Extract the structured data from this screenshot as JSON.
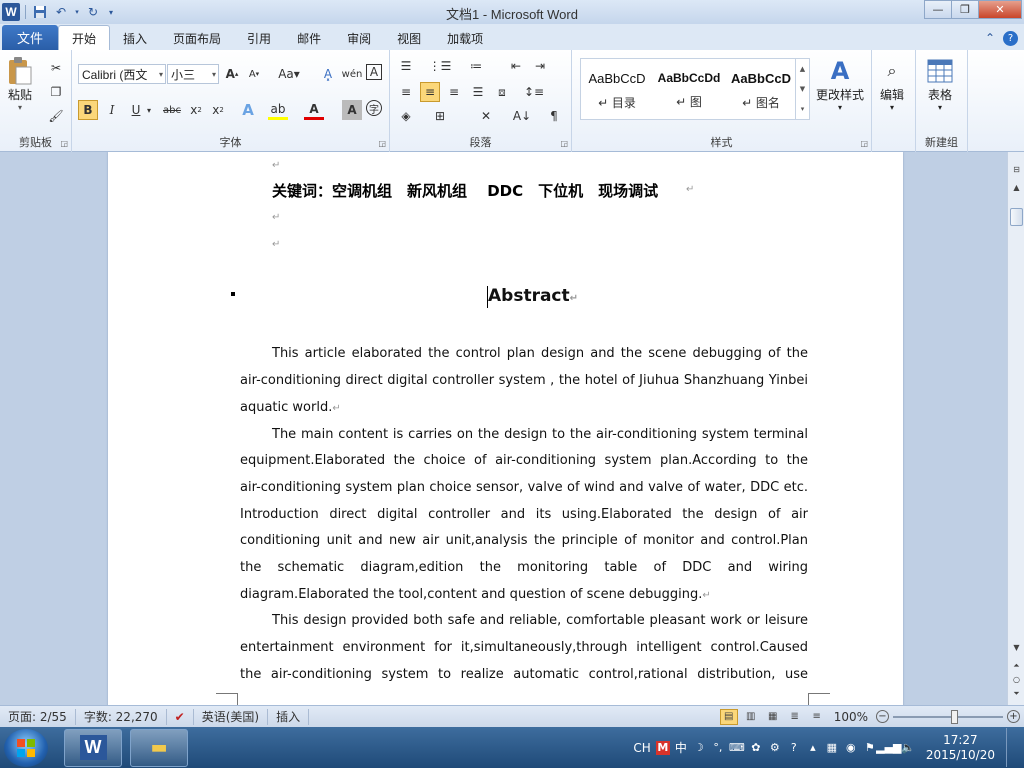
{
  "window": {
    "title": "文档1 - Microsoft Word"
  },
  "tabs": {
    "file": "文件",
    "items": [
      "开始",
      "插入",
      "页面布局",
      "引用",
      "邮件",
      "审阅",
      "视图",
      "加载项"
    ]
  },
  "ribbon": {
    "clipboard": {
      "label": "剪贴板",
      "paste": "粘贴"
    },
    "font": {
      "label": "字体",
      "font_name": "Calibri (西文",
      "font_size": "小三"
    },
    "paragraph": {
      "label": "段落"
    },
    "styles": {
      "label": "样式",
      "items": [
        {
          "preview": "AaBbCcD",
          "name": "↵ 目录"
        },
        {
          "preview": "AaBbCcDd",
          "name": "↵ 图"
        },
        {
          "preview": "AaBbCcD",
          "name": "↵ 图名"
        }
      ],
      "change_styles": "更改样式"
    },
    "editing": {
      "label": "编辑"
    },
    "newgroup": {
      "label": "新建组",
      "table": "表格"
    }
  },
  "document": {
    "keywords": "关键词：空调机组　新风机组　 DDC　下位机　现场调试",
    "abstract_title": "Abstract",
    "lines": [
      "This article elaborated the control plan design and the scene debugging of the",
      "air-conditioning direct digital controller system , the hotel of Jiuhua Shanzhuang Yinbei",
      "aquatic world.",
      "The main content is carries on the design to the air-conditioning system terminal",
      "equipment.Elaborated the choice of air-conditioning system plan.According to the",
      "air-conditioning system plan choice sensor, valve of wind and valve of water, DDC etc.",
      "Introduction direct digital controller and its using.Elaborated the design of air",
      "conditioning unit and new air unit,analysis the principle of monitor and control.Plan",
      "the schematic diagram,edition the monitoring table of DDC and wiring",
      "diagram.Elaborated the tool,content and question of scene debugging.",
      "This design provided both safe and reliable, comfortable pleasant work or leisure",
      "entertainment environment for it,simultaneously,through intelligent control.Caused",
      "the air-conditioning system to realize automatic control,rational distribution, use"
    ]
  },
  "statusbar": {
    "page": "页面: 2/55",
    "words": "字数: 22,270",
    "language": "英语(美国)",
    "mode": "插入",
    "zoom": "100%"
  },
  "taskbar": {
    "lang": "CH",
    "ime": "中",
    "time": "17:27",
    "date": "2015/10/20"
  }
}
